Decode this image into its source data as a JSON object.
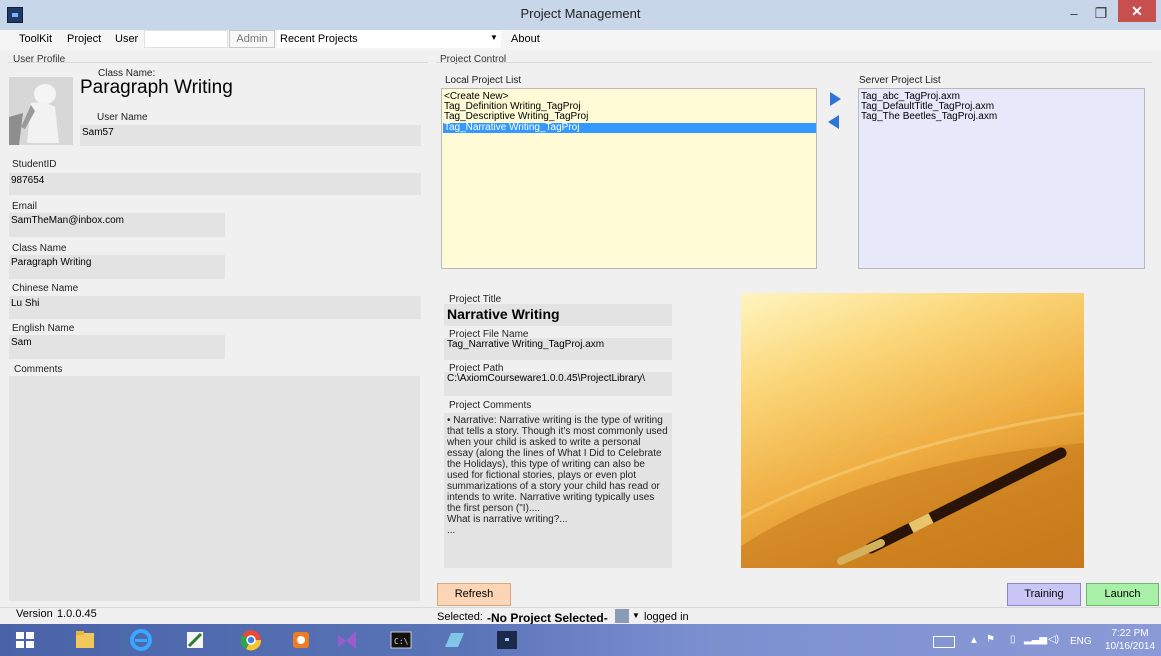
{
  "window": {
    "title": "Project Management",
    "minimize": "–",
    "maximize": "❐",
    "close": "✕"
  },
  "menu": {
    "toolkit": "ToolKit",
    "project": "Project",
    "user": "User",
    "admin": "Admin",
    "recent": "Recent Projects",
    "about": "About"
  },
  "profile": {
    "group": "User Profile",
    "class_name_label": "Class Name:",
    "class_name_value": "Paragraph Writing",
    "user_name_label": "User Name",
    "user_name_value": "Sam57",
    "student_id_label": "StudentID",
    "student_id_value": "987654",
    "email_label": "Email",
    "email_value": "SamTheMan@inbox.com",
    "class_label": "Class Name",
    "class_value": "Paragraph Writing",
    "chinese_label": "Chinese Name",
    "chinese_value": "Lu Shi",
    "english_label": "English Name",
    "english_value": "Sam",
    "comments_label": "Comments"
  },
  "control": {
    "group": "Project Control",
    "local_label": "Local Project List",
    "local_items": [
      "<Create New>",
      "Tag_Definition Writing_TagProj",
      "Tag_Descriptive Writing_TagProj",
      "Tag_Narrative Writing_TagProj"
    ],
    "server_label": "Server Project List",
    "server_items": [
      "Tag_abc_TagProj.axm",
      "Tag_DefaultTitle_TagProj.axm",
      "Tag_The Beetles_TagProj.axm"
    ]
  },
  "details": {
    "title_label": "Project Title",
    "title_value": "Narrative Writing",
    "file_label": "Project File Name",
    "file_value": "Tag_Narrative Writing_TagProj.axm",
    "path_label": "Project Path",
    "path_value": "C:\\AxiomCourseware1.0.0.45\\ProjectLibrary\\",
    "comments_label": "Project Comments",
    "comments_value": "• Narrative: Narrative writing is the type of writing that tells a story. Though it’s most commonly used when your child is asked to write a personal essay (along the lines of  What I Did to Celebrate the Holidays), this type of writing can also be used for fictional stories, plays or even plot summarizations of a story your child has read or intends to write. Narrative writing typically uses the first person (\"I)....\nWhat is narrative writing?...\n..."
  },
  "buttons": {
    "refresh": "Refresh",
    "training": "Training",
    "launch": "Launch"
  },
  "status": {
    "version_label": "Version",
    "version_value": "1.0.0.45",
    "selected_label": "Selected:",
    "selected_value": "-No Project Selected-",
    "logged_in": "logged in"
  },
  "taskbar": {
    "lang": "ENG",
    "time": "7:22 PM",
    "date": "10/16/2014"
  },
  "colors": {
    "selection": "#3399ff",
    "local_list_bg": "#fffbd6",
    "server_list_bg": "#e7e8fa",
    "refresh": "#fbd5b5",
    "training": "#c9c6f5",
    "launch": "#a8f0a8",
    "close": "#c7504e"
  }
}
